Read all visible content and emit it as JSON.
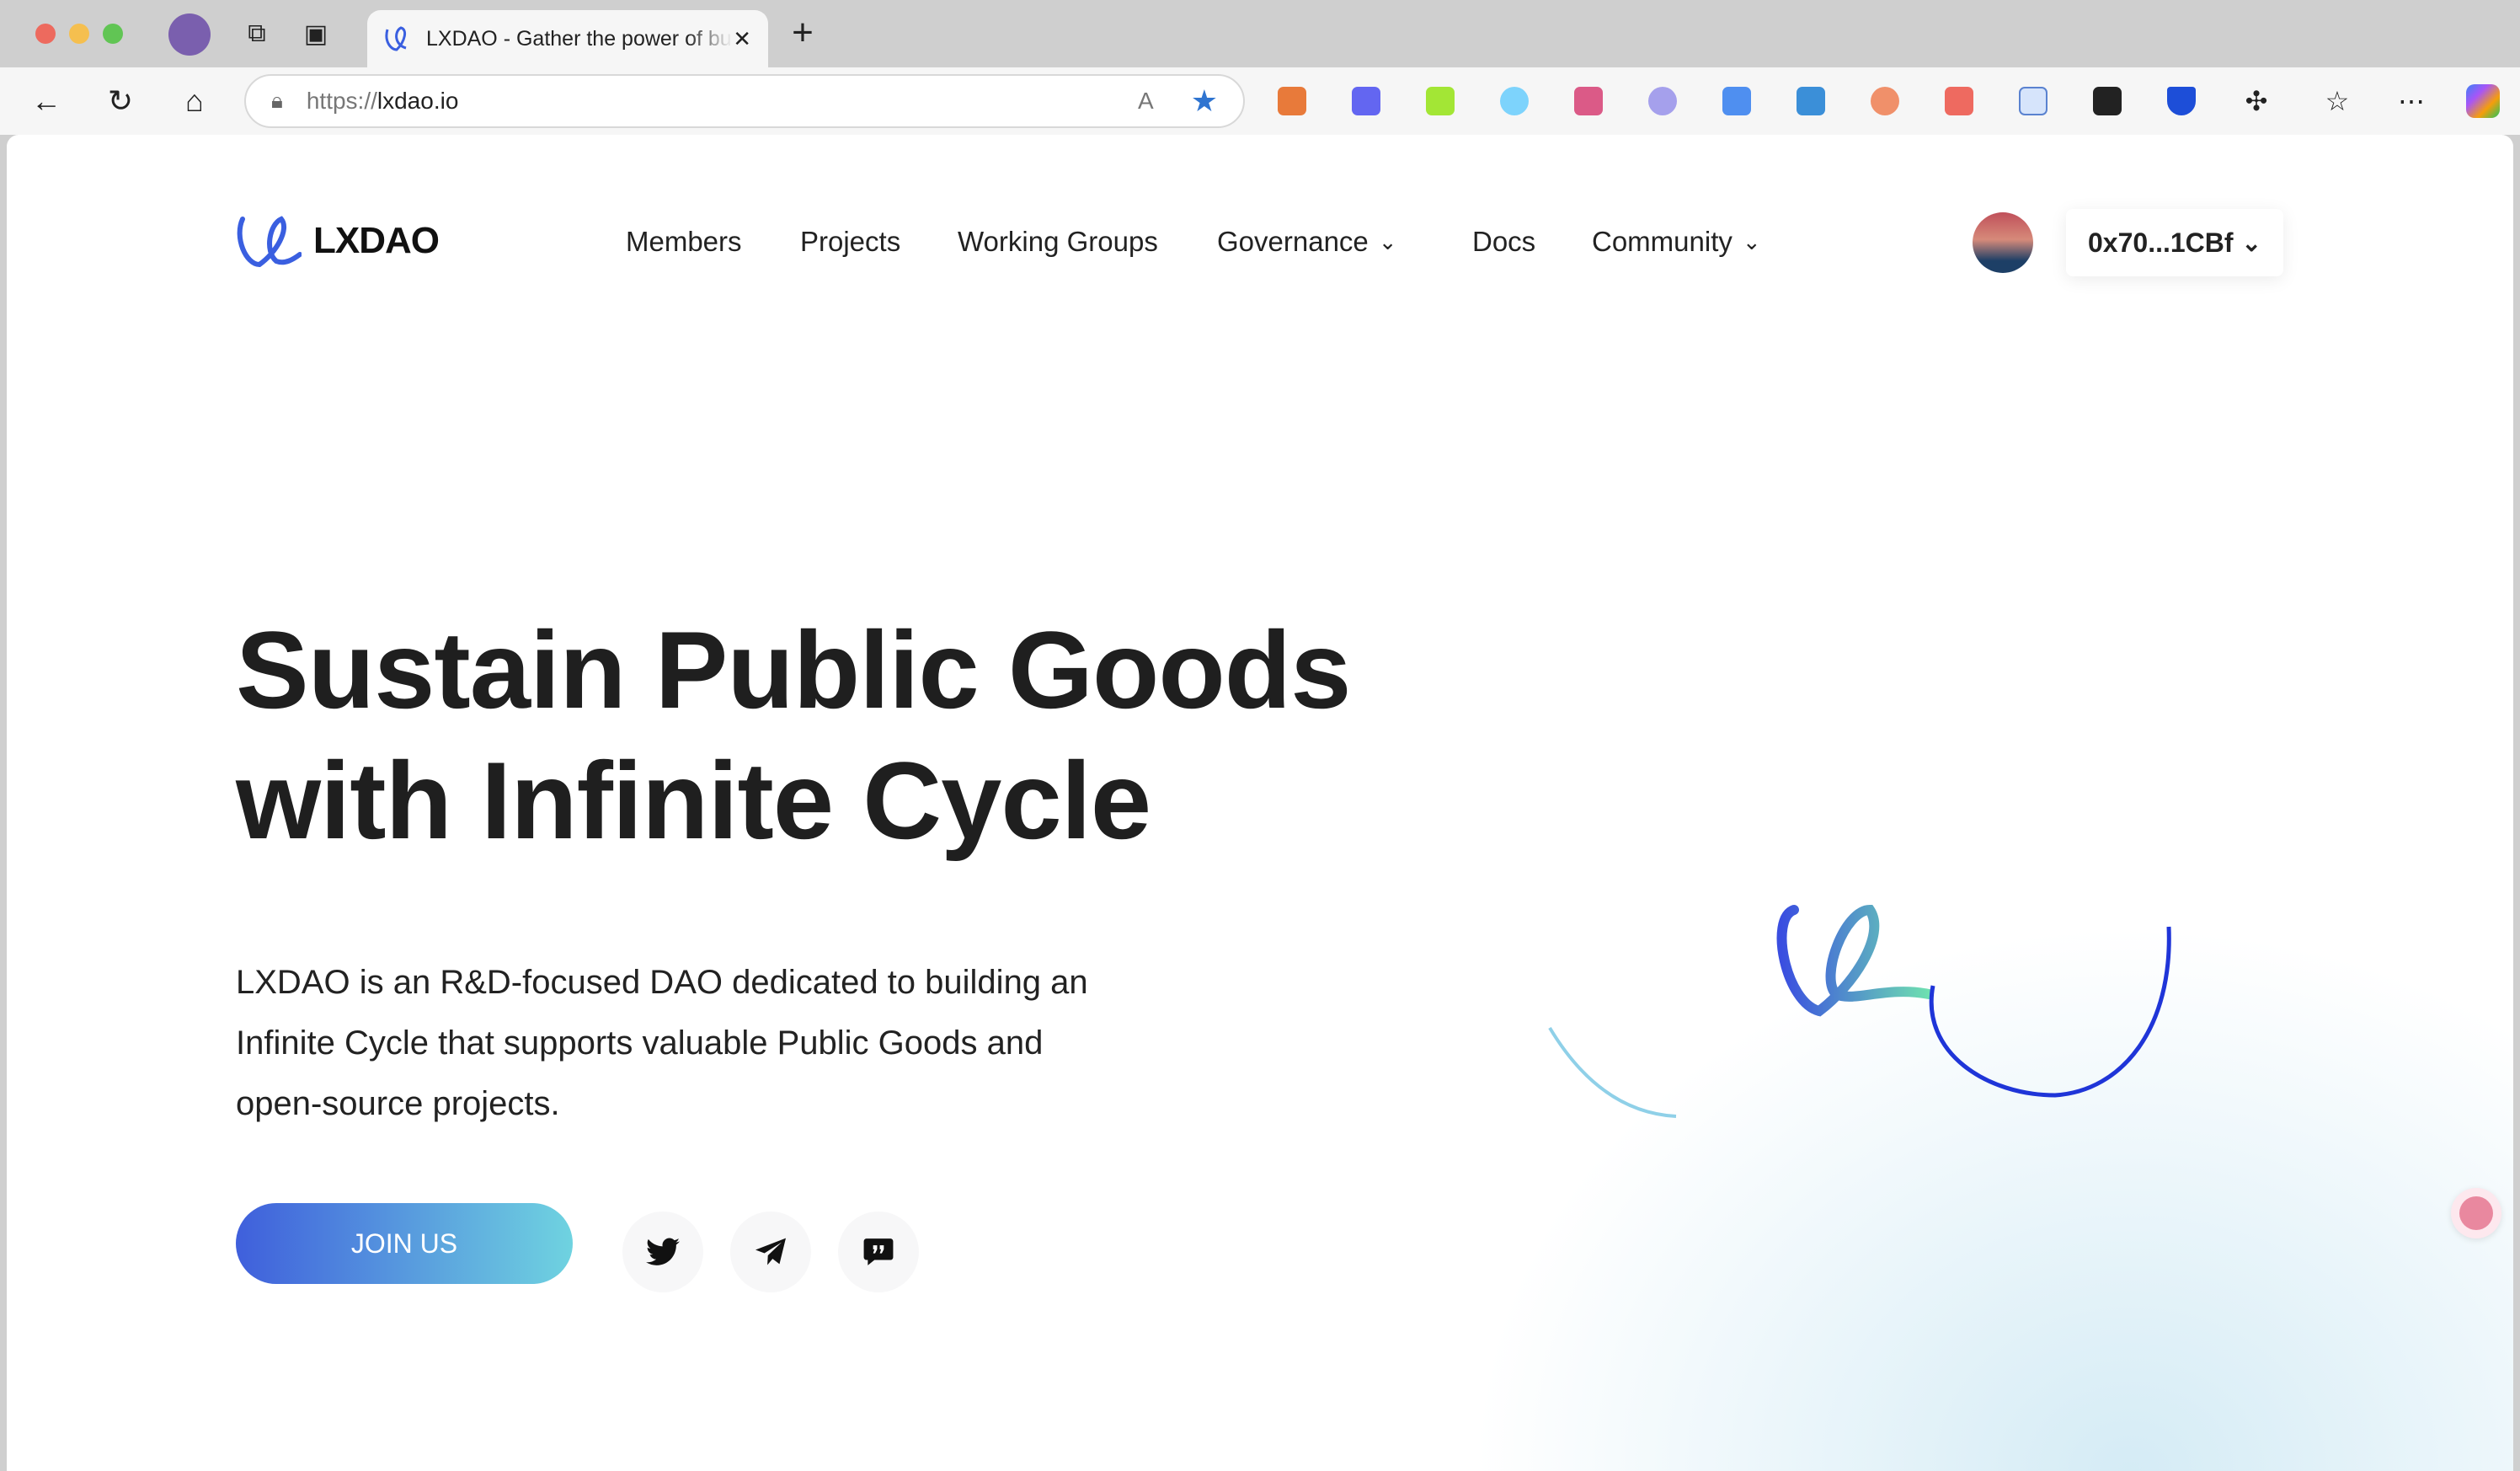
{
  "browser": {
    "tab_title": "LXDAO - Gather the power of buidlers",
    "url_scheme": "https://",
    "url_host": "lxdao.io",
    "new_tab": "+",
    "close": "✕"
  },
  "brand": {
    "name": "LXDAO"
  },
  "nav": [
    {
      "label": "Members"
    },
    {
      "label": "Projects"
    },
    {
      "label": "Working Groups"
    },
    {
      "label": "Governance",
      "dropdown": true
    },
    {
      "label": "Docs"
    },
    {
      "label": "Community",
      "dropdown": true
    }
  ],
  "wallet": {
    "address": "0x70...1CBf"
  },
  "hero": {
    "line1": "Sustain Public Goods",
    "line2": "with Infinite Cycle",
    "desc1": "LXDAO is an R&D-focused DAO dedicated to building an",
    "desc2": "Infinite Cycle that supports valuable Public Goods and",
    "desc3": "open-source projects.",
    "cta": "JOIN US"
  },
  "social": [
    "twitter-icon",
    "telegram-icon",
    "discord-icon"
  ],
  "colors": {
    "accent_start": "#3f5fdc",
    "accent_end": "#6fd3e0"
  }
}
